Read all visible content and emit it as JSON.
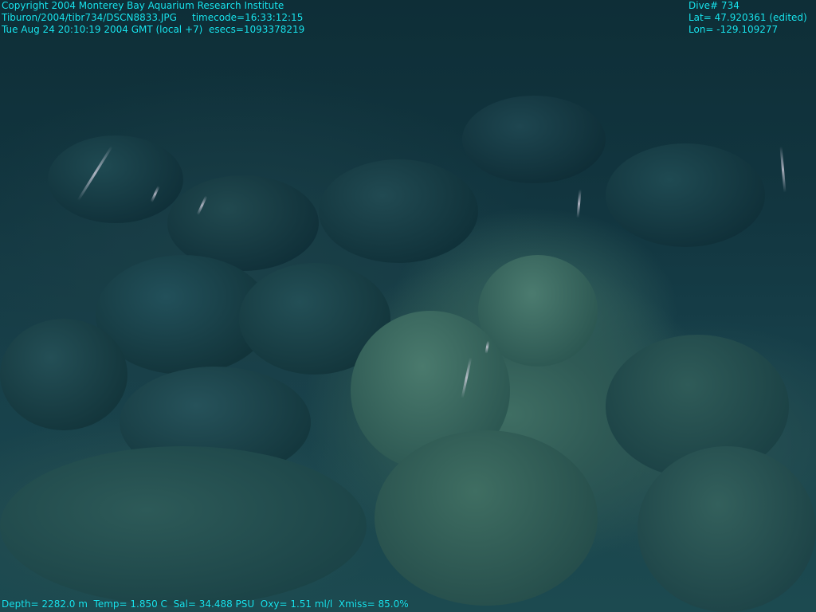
{
  "overlay": {
    "top_left": {
      "line1": "Copyright 2004 Monterey Bay Aquarium Research Institute",
      "line2": "Tiburon/2004/tibr734/DSCN8833.JPG     timecode=16:33:12:15",
      "line3": "Tue Aug 24 20:10:19 2004 GMT (local +7)  esecs=1093378219"
    },
    "top_right": {
      "dive": "Dive# 734",
      "lat": "Lat= 47.920361 (edited)",
      "lon": "Lon= -129.109277"
    },
    "bottom": {
      "telemetry": "Depth= 2282.0 m  Temp= 1.850 C  Sal= 34.488 PSU  Oxy= 1.51 ml/l  Xmiss= 85.0%"
    },
    "text_color": "#19e6f0"
  },
  "scene": {
    "description_colors": {
      "water_dark": "#0e2e37",
      "rock_light": "#3f6e63",
      "rock_mid": "#2f5a55"
    }
  }
}
